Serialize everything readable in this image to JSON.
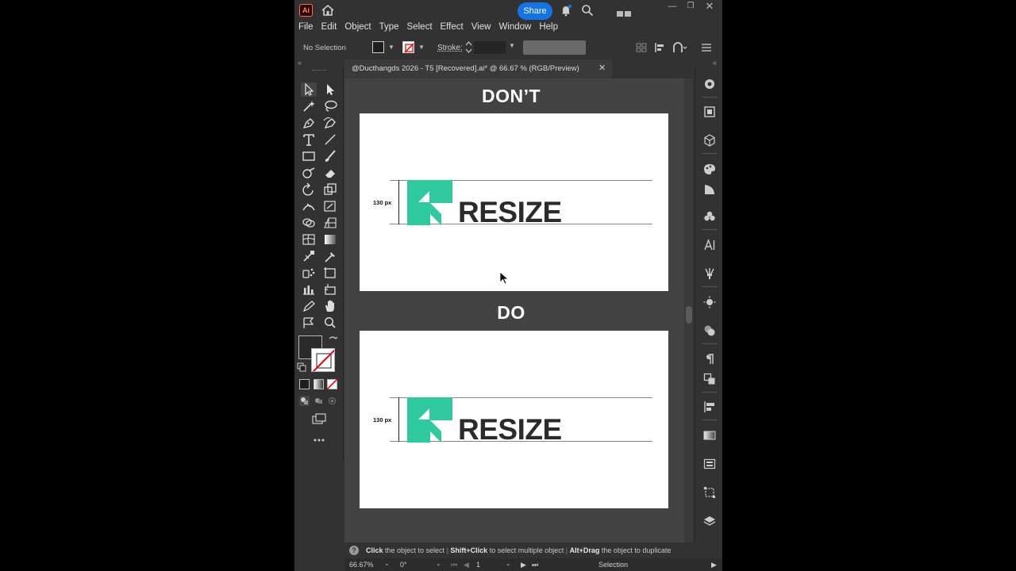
{
  "app": {
    "logo": "Ai",
    "share_label": "Share"
  },
  "menu": [
    "File",
    "Edit",
    "Object",
    "Type",
    "Select",
    "Effect",
    "View",
    "Window",
    "Help"
  ],
  "control": {
    "selection": "No Selection",
    "stroke_label": "Stroke:"
  },
  "document": {
    "tab_title": "@Ducthangds 2026 - T5 [Recovered].ai* @ 66.67 % (RGB/Preview)",
    "close": "✕"
  },
  "artboards": [
    {
      "heading": "DON’T",
      "dim_label": "130 px",
      "logo_text": "RESIZE"
    },
    {
      "heading": "DO",
      "dim_label": "130 px",
      "logo_text": "RESIZE"
    }
  ],
  "colors": {
    "logo_green": "#2ec99e",
    "accent": "#1473e6"
  },
  "hint": {
    "part1_bold": "Click",
    "part1": " the object to select",
    "part2_bold": "Shift+Click",
    "part2": " to select multiple object",
    "part3_bold": "Alt+Drag",
    "part3": " the object to duplicate"
  },
  "status": {
    "zoom": "66.67%",
    "rotation": "0°",
    "artboard_number": "1",
    "mode": "Selection"
  }
}
